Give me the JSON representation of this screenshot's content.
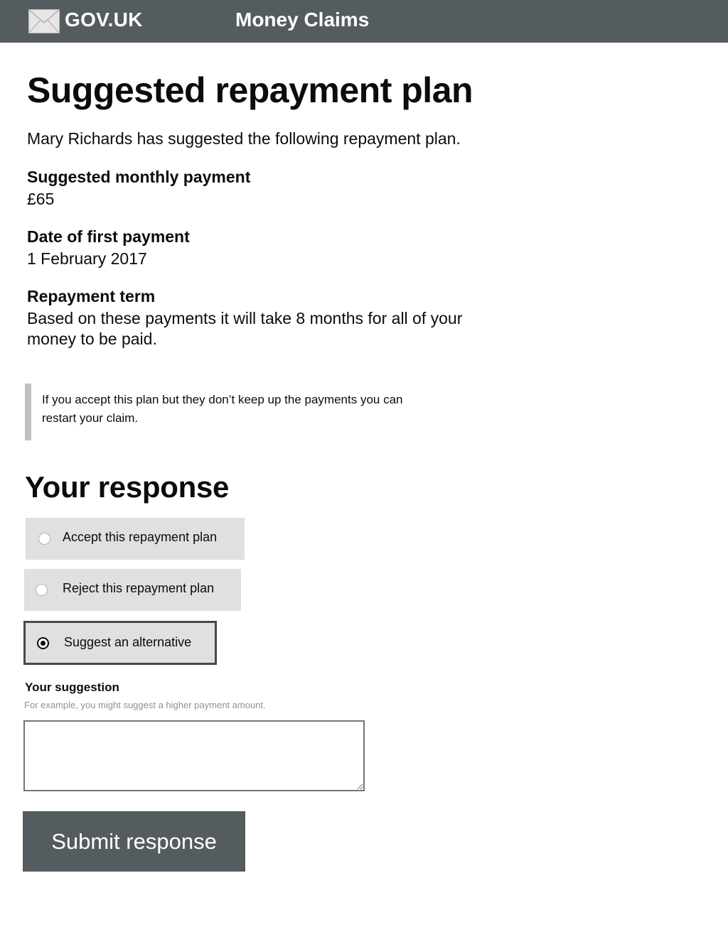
{
  "header": {
    "logo_icon": "crown-envelope-icon",
    "logo_text": "GOV.UK",
    "service_name": "Money Claims",
    "background": "#555c60"
  },
  "page": {
    "title": "Suggested repayment plan",
    "intro": "Mary Richards has suggested the following repayment plan."
  },
  "plan": {
    "monthly_label": "Suggested monthly payment",
    "monthly_value": "£65",
    "first_label": "Date of first payment",
    "first_value": "1 February 2017",
    "term_label": "Repayment term",
    "term_value": "Based on these payments it will take 8 months for all of your money to be paid."
  },
  "inset": {
    "text": "If you accept this plan but they don’t keep up the payments you can restart your claim."
  },
  "response": {
    "heading": "Your response",
    "options": [
      {
        "label": "Accept this repayment plan",
        "selected": false
      },
      {
        "label": "Reject this repayment plan",
        "selected": false
      },
      {
        "label": "Suggest an alternative",
        "selected": true
      }
    ],
    "suggestion_label": "Your suggestion",
    "suggestion_hint": "For example, you might suggest a higher payment amount.",
    "suggestion_value": ""
  },
  "actions": {
    "submit_label": "Submit response"
  }
}
